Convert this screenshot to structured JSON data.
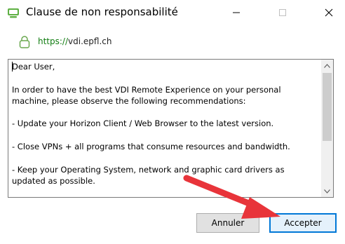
{
  "window": {
    "title": "Clause de non responsabilité"
  },
  "titlebar_icons": {
    "app": "horizon-client-icon",
    "minimize": "minimize-icon",
    "maximize": "maximize-icon",
    "close": "close-icon"
  },
  "address": {
    "scheme": "https://",
    "host": "vdi.epfl.ch",
    "lock_icon": "lock-icon"
  },
  "disclaimer": {
    "text": "Dear User,\n\nIn order to have the best VDI Remote Experience on your personal machine, please observe the following recommendations:\n\n- Update your Horizon Client / Web Browser to the latest version.\n\n- Close VPNs + all programs that consume resources and bandwidth.\n\n- Keep your Operating System, network and graphic card drivers as updated as possible."
  },
  "buttons": {
    "cancel_label": "Annuler",
    "accept_label": "Accepter"
  },
  "colors": {
    "accent": "#0078d7",
    "annotation_arrow": "#e8343a",
    "secure_green": "#107c10"
  }
}
